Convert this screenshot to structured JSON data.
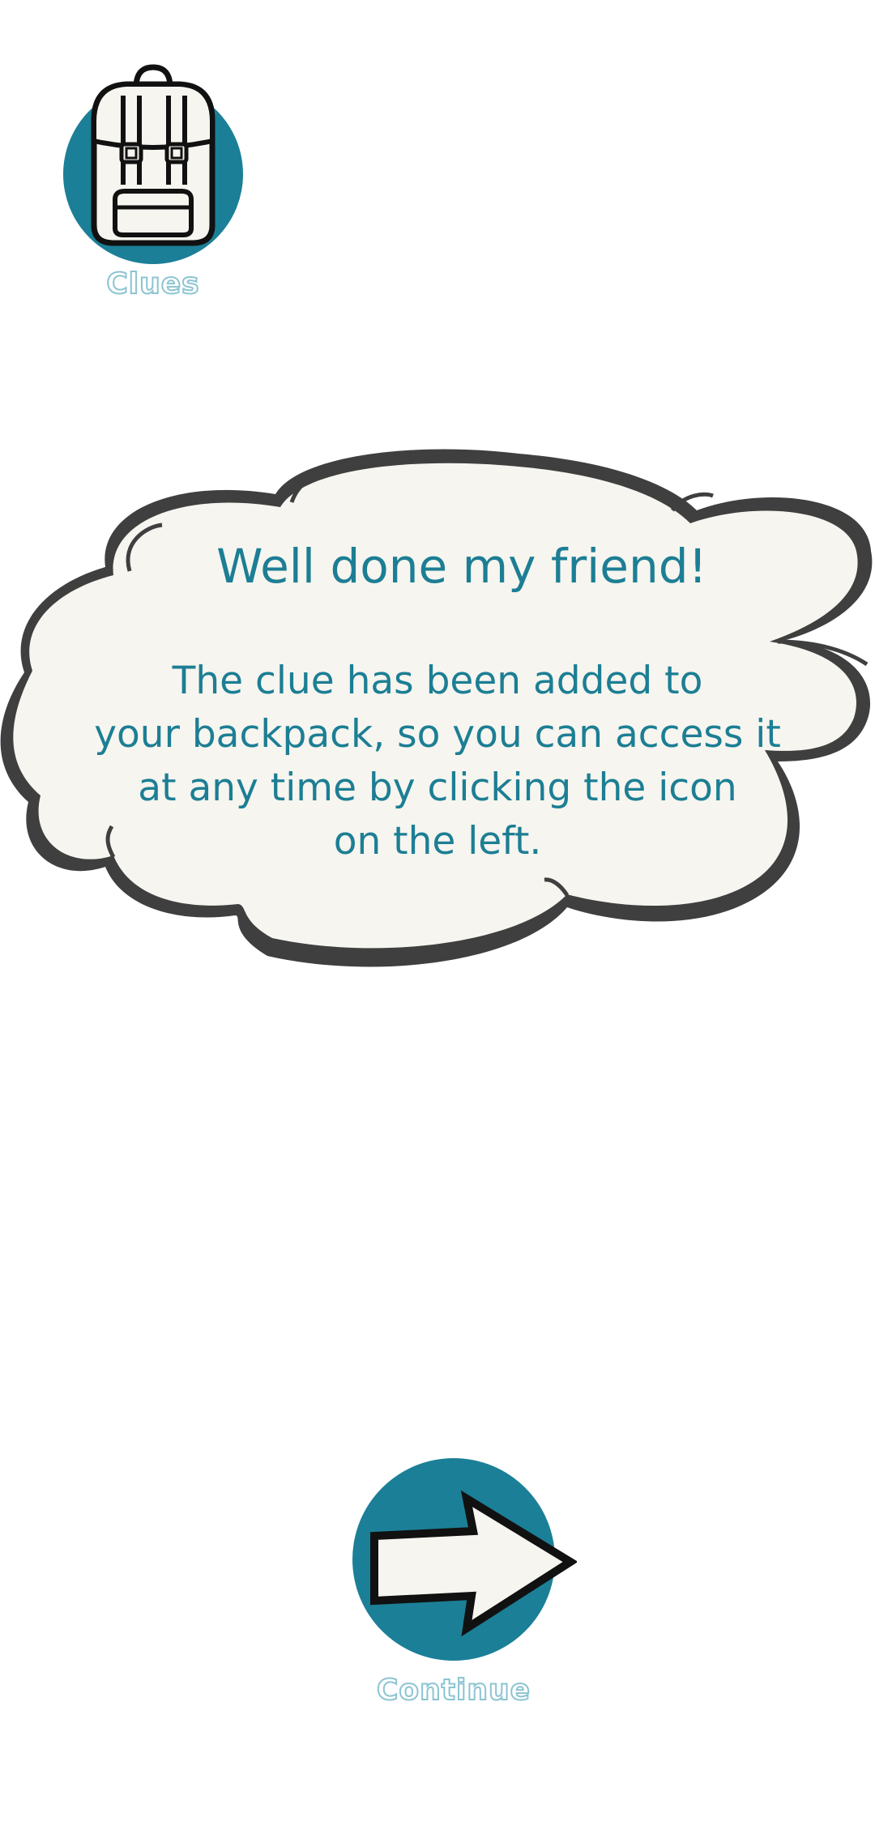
{
  "clues_button": {
    "label": "Clues",
    "icon": "backpack-icon"
  },
  "dialog": {
    "title": "Well done my friend!",
    "body_lines": [
      "The clue has been added to",
      "your backpack, so you can access it",
      "at any time by clicking the icon",
      "on the left."
    ]
  },
  "continue_button": {
    "label": "Continue",
    "icon": "arrow-right-icon"
  },
  "colors": {
    "accent": "#1b7f97",
    "text": "#1c7e94",
    "cloud_fill": "#f6f5ef",
    "cloud_outline": "#444444",
    "label_outline": "#8cc4d2"
  }
}
